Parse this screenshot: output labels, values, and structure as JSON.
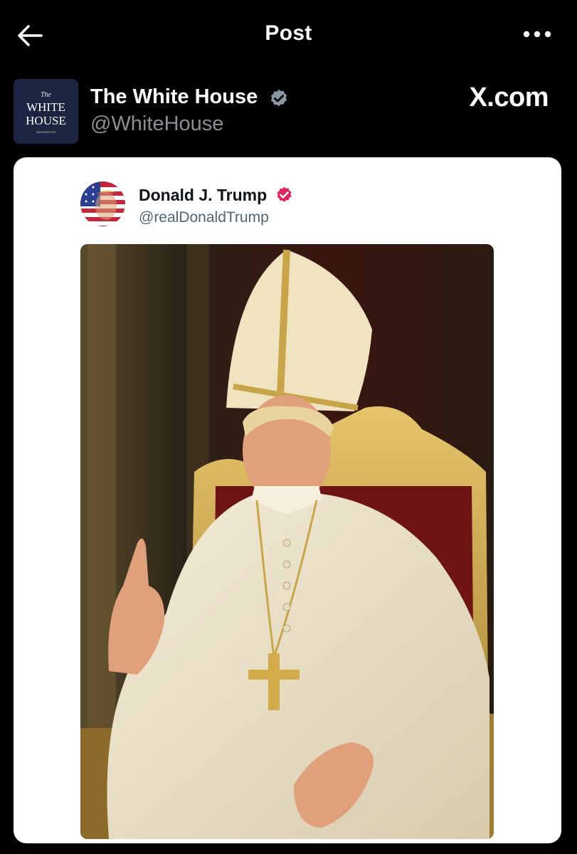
{
  "header": {
    "title": "Post",
    "back_icon": "arrow-left-icon",
    "more_icon": "more-horizontal-icon"
  },
  "author": {
    "name": "The White House",
    "handle": "@WhiteHouse",
    "verified": true,
    "avatar_text": {
      "line1": "The",
      "line2": "WHITE",
      "line3": "HOUSE",
      "line4": "WASHINGTON"
    }
  },
  "watermark": "X.com",
  "embedded_post": {
    "name": "Donald J. Trump",
    "handle": "@realDonaldTrump",
    "verified": true,
    "image_description_icon": "pope-portrait-image"
  },
  "colors": {
    "background": "#000000",
    "card": "#ffffff",
    "verified_blue": "#1d9bf0",
    "verified_red": "#e0245e",
    "secondary_text": "#8b8f94"
  }
}
